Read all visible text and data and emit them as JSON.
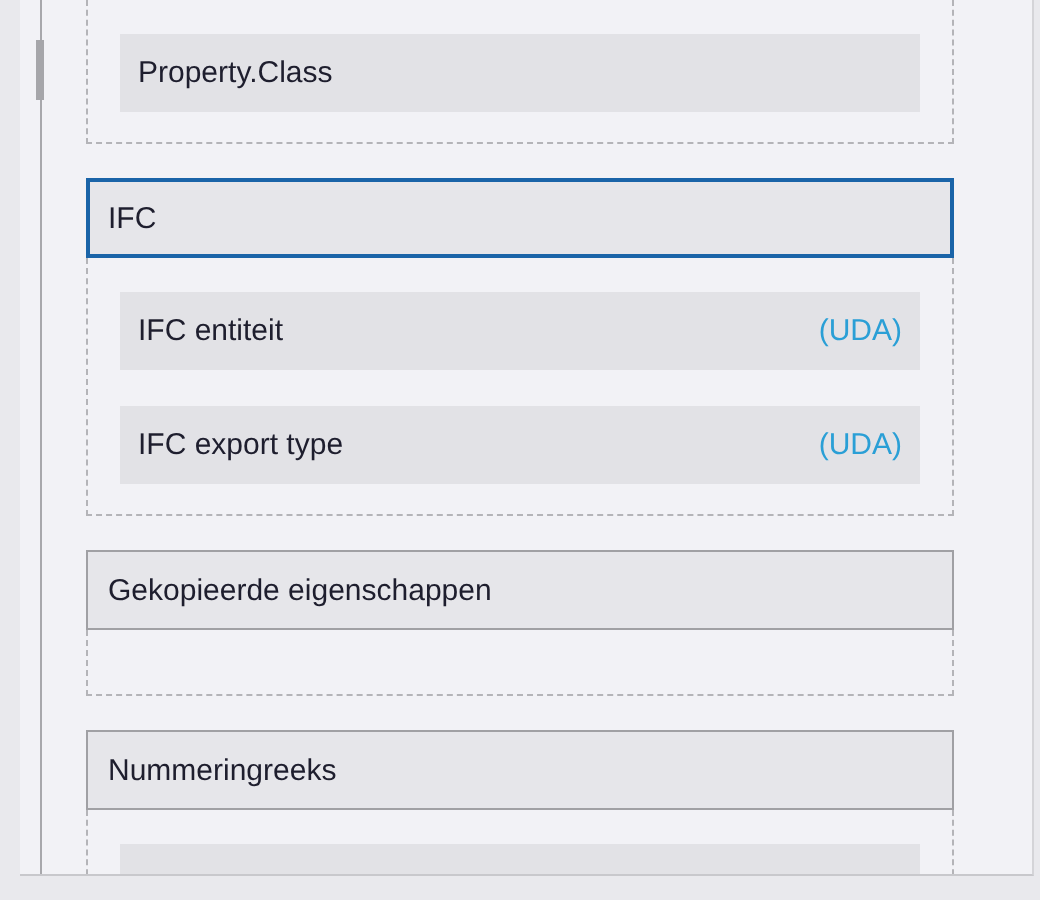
{
  "groups": [
    {
      "items": [
        {
          "label": "Property.Class"
        }
      ]
    },
    {
      "header": {
        "label": "IFC",
        "selected": true
      },
      "items": [
        {
          "label": "IFC entiteit",
          "tag": "(UDA)"
        },
        {
          "label": "IFC export type",
          "tag": "(UDA)"
        }
      ]
    },
    {
      "header": {
        "label": "Gekopieerde eigenschappen",
        "selected": false
      }
    },
    {
      "header": {
        "label": "Nummeringreeks",
        "selected": false
      },
      "more_below": true
    }
  ]
}
